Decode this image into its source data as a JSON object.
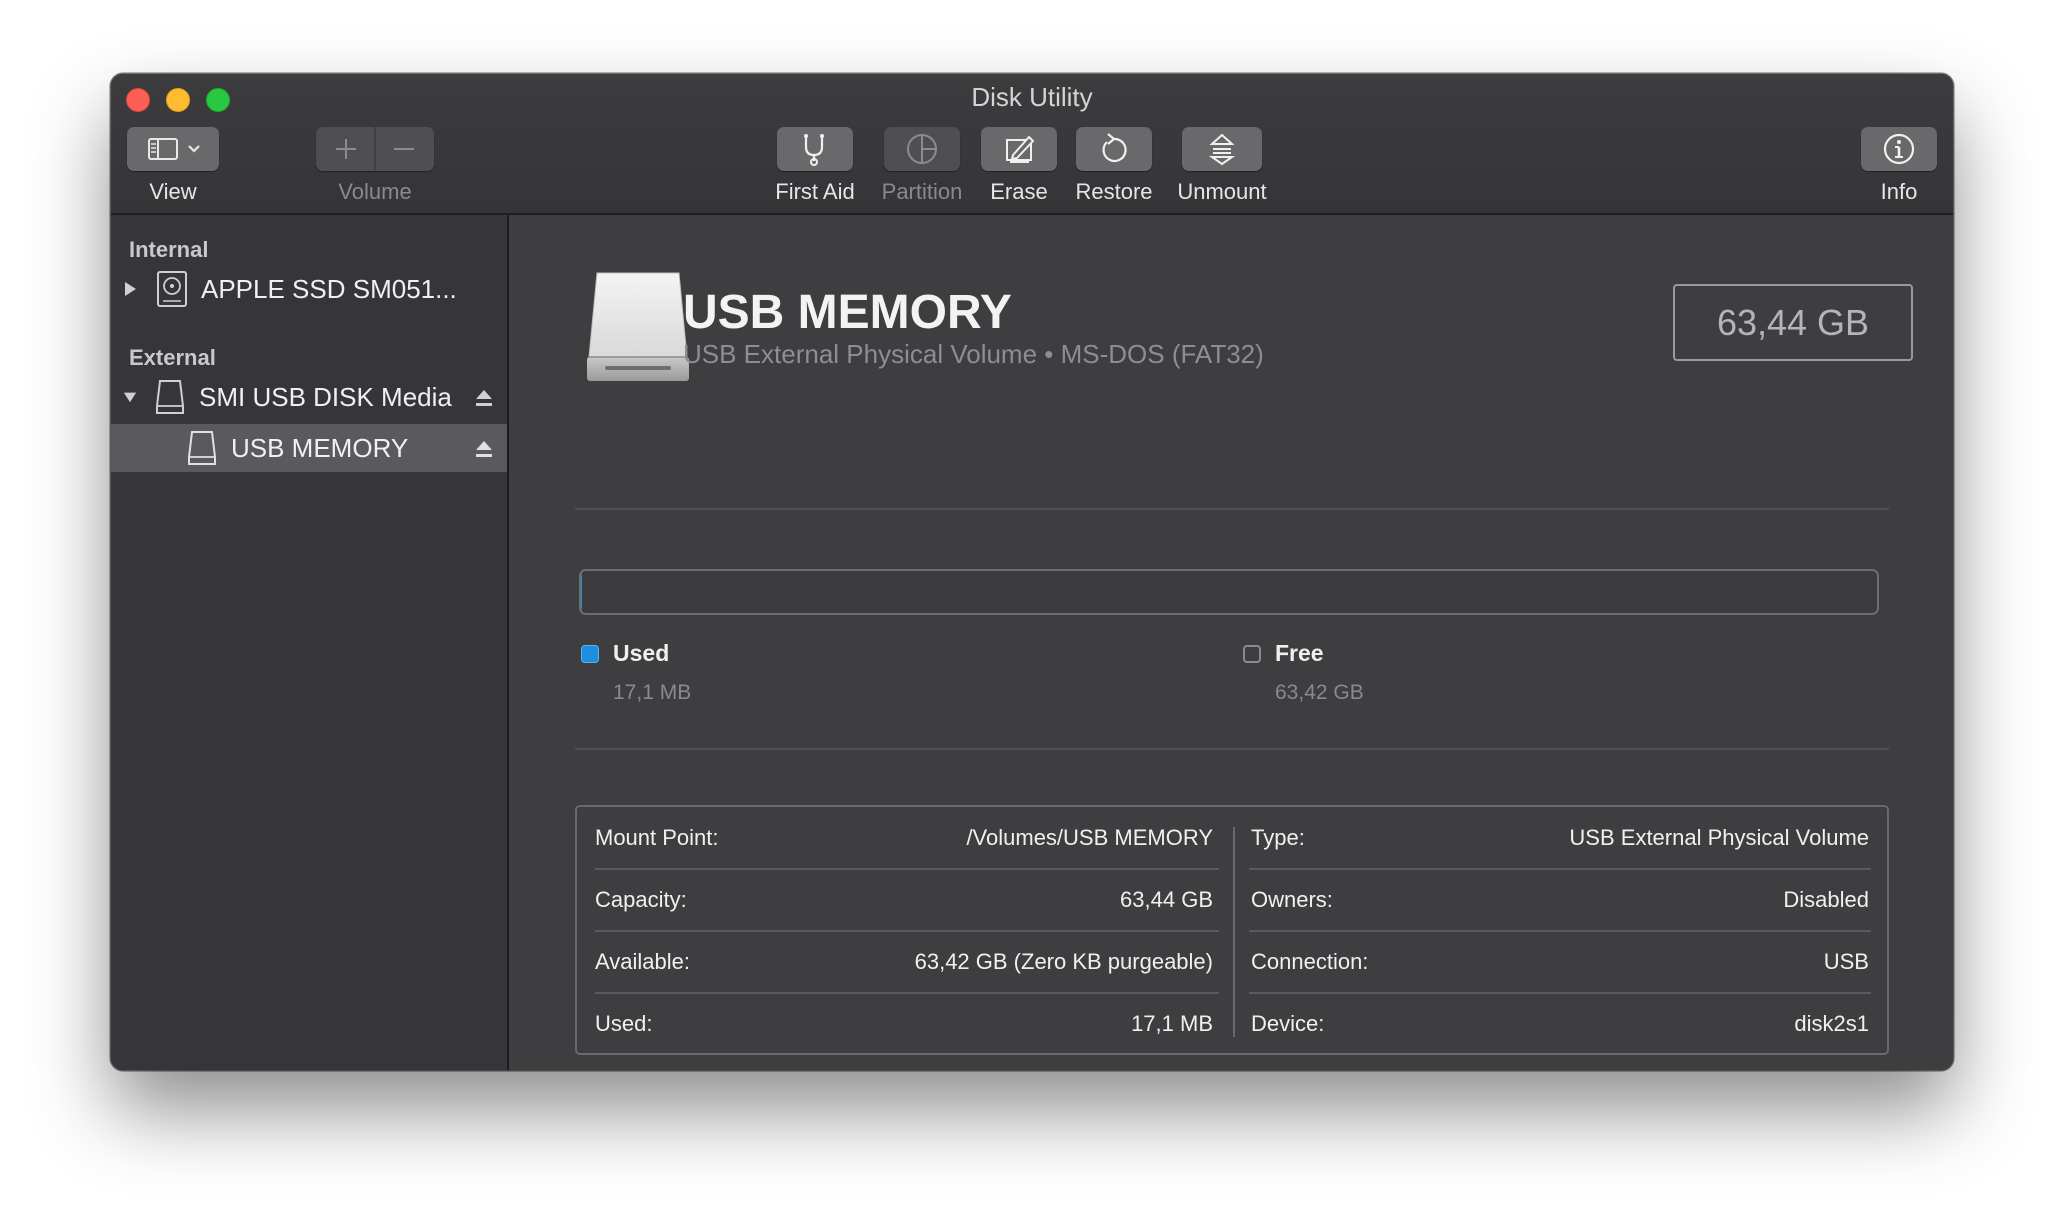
{
  "window": {
    "title": "Disk Utility"
  },
  "toolbar": {
    "view_label": "View",
    "volume_label": "Volume",
    "first_aid_label": "First Aid",
    "partition_label": "Partition",
    "erase_label": "Erase",
    "restore_label": "Restore",
    "unmount_label": "Unmount",
    "info_label": "Info"
  },
  "sidebar": {
    "internal_header": "Internal",
    "external_header": "External",
    "items": [
      {
        "label": "APPLE SSD SM051...",
        "icon": "internal-disk-icon",
        "expanded": false
      },
      {
        "label": "SMI USB DISK Media",
        "icon": "external-disk-icon",
        "expanded": true
      },
      {
        "label": "USB MEMORY",
        "icon": "volume-icon",
        "selected": true
      }
    ]
  },
  "volume": {
    "name": "USB MEMORY",
    "subtitle": "USB External Physical Volume • MS-DOS (FAT32)",
    "capacity": "63,44 GB"
  },
  "usage": {
    "used_fraction": 0.0003,
    "used_label": "Used",
    "used_value": "17,1 MB",
    "free_label": "Free",
    "free_value": "63,42 GB",
    "used_color": "#1d8fe0"
  },
  "info": {
    "left": [
      {
        "label": "Mount Point:",
        "value": "/Volumes/USB MEMORY"
      },
      {
        "label": "Capacity:",
        "value": "63,44 GB"
      },
      {
        "label": "Available:",
        "value": "63,42 GB (Zero KB purgeable)"
      },
      {
        "label": "Used:",
        "value": "17,1 MB"
      }
    ],
    "right": [
      {
        "label": "Type:",
        "value": "USB External Physical Volume"
      },
      {
        "label": "Owners:",
        "value": "Disabled"
      },
      {
        "label": "Connection:",
        "value": "USB"
      },
      {
        "label": "Device:",
        "value": "disk2s1"
      }
    ]
  }
}
